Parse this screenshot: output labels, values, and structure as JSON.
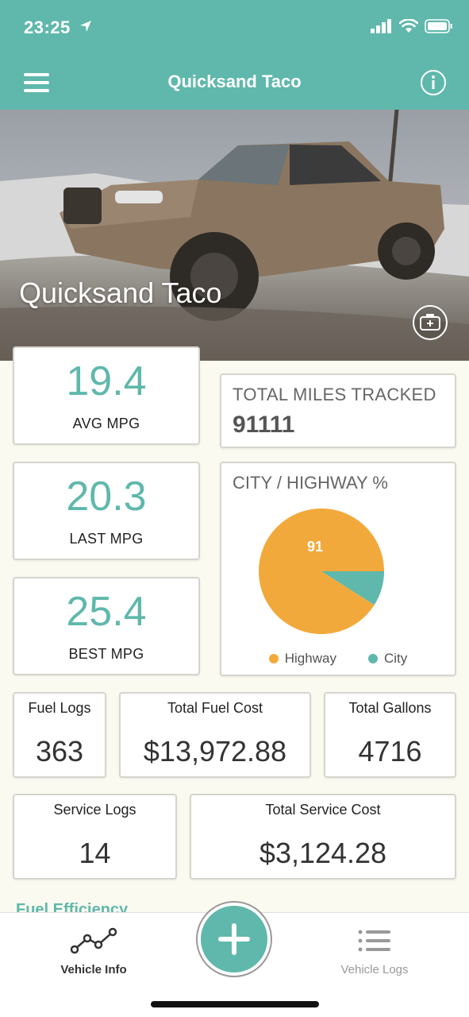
{
  "status_bar": {
    "time": "23:25"
  },
  "nav": {
    "title": "Quicksand Taco"
  },
  "hero": {
    "vehicle_name": "Quicksand Taco"
  },
  "stats": {
    "avg_mpg": {
      "value": "19.4",
      "label": "AVG MPG"
    },
    "last_mpg": {
      "value": "20.3",
      "label": "LAST MPG"
    },
    "best_mpg": {
      "value": "25.4",
      "label": "BEST MPG"
    }
  },
  "miles": {
    "label": "TOTAL MILES TRACKED",
    "value": "91111"
  },
  "chart_data": {
    "type": "pie",
    "title": "CITY / HIGHWAY %",
    "labels": [
      "Highway",
      "City"
    ],
    "values": [
      91,
      9
    ],
    "data_labels": [
      "91",
      ""
    ],
    "colors": [
      "#f2a93b",
      "#5fb8ab"
    ],
    "legend_position": "bottom"
  },
  "summary": {
    "fuel_logs": {
      "label": "Fuel Logs",
      "value": "363"
    },
    "total_fuel_cost": {
      "label": "Total Fuel Cost",
      "value": "$13,972.88"
    },
    "total_gallons": {
      "label": "Total Gallons",
      "value": "4716"
    },
    "service_logs": {
      "label": "Service Logs",
      "value": "14"
    },
    "total_service_cost": {
      "label": "Total Service Cost",
      "value": "$3,124.28"
    }
  },
  "section_peek": "Fuel Efficiency",
  "tabs": [
    {
      "label": "Vehicle Info",
      "icon": "line-chart-icon"
    },
    {
      "label": "Vehicle Logs",
      "icon": "list-icon"
    }
  ],
  "colors": {
    "accent": "#5fb8ab",
    "highway": "#f2a93b",
    "city": "#5fb8ab"
  }
}
